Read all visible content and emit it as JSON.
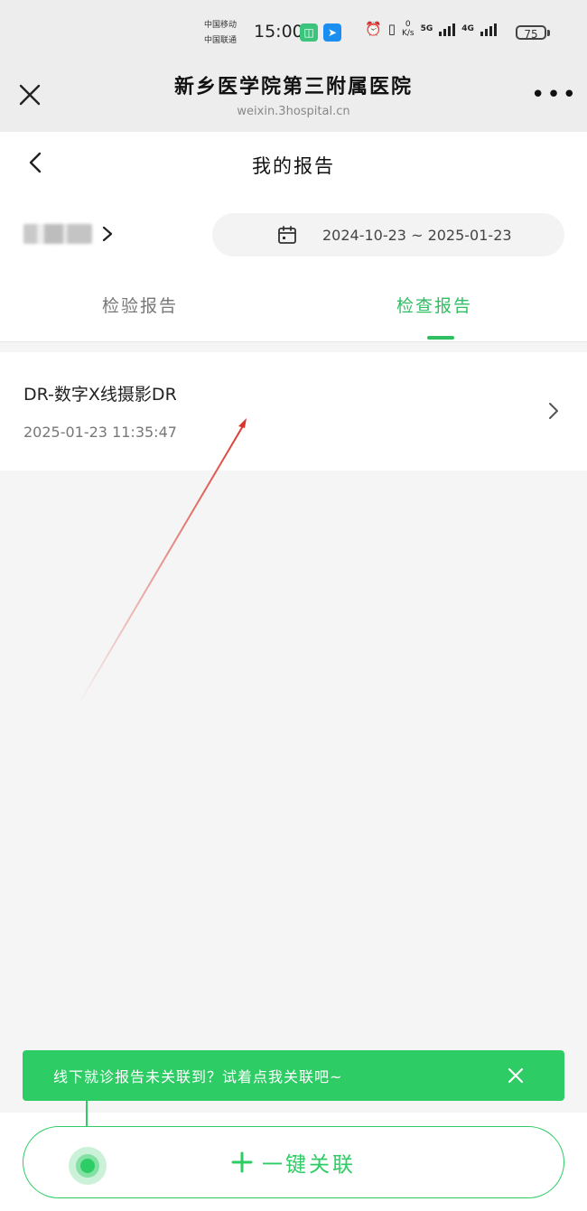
{
  "status_bar": {
    "carrier_1": "中国移动",
    "carrier_2": "中国联通",
    "time": "15:00",
    "netspeed_value": "0",
    "netspeed_unit": "K/s",
    "signal_1": "5G",
    "signal_2": "4G",
    "battery": "75"
  },
  "wechat_header": {
    "title": "新乡医学院第三附属医院",
    "domain": "weixin.3hospital.cn",
    "more": "•••"
  },
  "page": {
    "title": "我的报告"
  },
  "filter": {
    "date_range": "2024-10-23 ~ 2025-01-23"
  },
  "tabs": [
    {
      "label": "检验报告",
      "active": false
    },
    {
      "label": "检查报告",
      "active": true
    }
  ],
  "reports": [
    {
      "name": "DR-数字X线摄影DR",
      "time": "2025-01-23 11:35:47"
    }
  ],
  "tip": {
    "text": "线下就诊报告未关联到？试着点我关联吧~"
  },
  "bottom_button": {
    "label": "一键关联"
  },
  "colors": {
    "accent": "#2ecc65",
    "annotation_arrow": "#d9352b"
  }
}
